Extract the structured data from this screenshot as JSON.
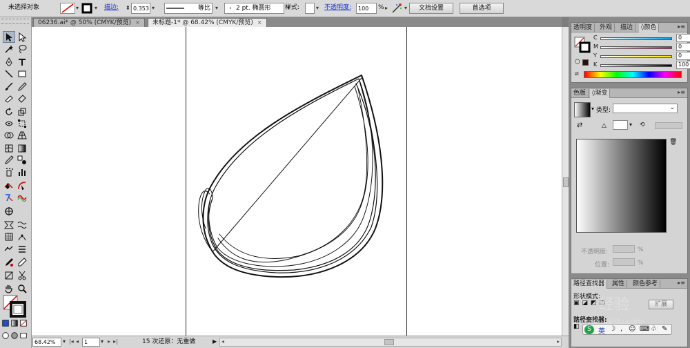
{
  "control_bar": {
    "selection_status": "未选择对象",
    "stroke_label": "描边:",
    "stroke_weight": "0.353",
    "profile_label": "等比",
    "brush_label": "2 pt. 椭圆形",
    "style_label": "样式:",
    "opacity_label": "不透明度:",
    "opacity_value": "100",
    "percent": "%",
    "doc_setup_button": "文档设置",
    "preferences_button": "首选项"
  },
  "document_tabs": [
    {
      "label": "06236.ai* @ 50% (CMYK/预览)",
      "close": "×"
    },
    {
      "label": "未标题-1* @ 68.42% (CMYK/预览)",
      "close": "×"
    }
  ],
  "status_bar": {
    "zoom": "68.42%",
    "page": "1",
    "status_text": "15 次还原：无重做"
  },
  "color_panel": {
    "tabs": [
      "透明度",
      "外观",
      "描边",
      "颜色"
    ],
    "active_tab": "颜色",
    "channels": [
      {
        "label": "C",
        "value": "0",
        "unit": "%"
      },
      {
        "label": "M",
        "value": "0",
        "unit": "%"
      },
      {
        "label": "Y",
        "value": "0",
        "unit": "%"
      },
      {
        "label": "K",
        "value": "100",
        "unit": "%"
      }
    ]
  },
  "gradient_panel": {
    "tabs": [
      "色板",
      "渐变"
    ],
    "active_tab": "渐变",
    "type_label": "类型:",
    "opacity_label": "不透明度:",
    "location_label": "位置:",
    "percent": "%"
  },
  "bottom_panel": {
    "tabs": [
      "路径查找器",
      "属性",
      "颜色参考"
    ],
    "active_tab": "路径查找器",
    "shape_modes_label": "形状模式:",
    "expand_button": "扩展",
    "pathfinders_label": "路径查找器:"
  },
  "watermark": {
    "text": "经验",
    "url": "jingyan.baidu.com"
  },
  "ime_bar": {
    "mode": "英"
  },
  "colors": {
    "ui_gray": "#d4d4d4",
    "workspace": "#8a8a8a",
    "link_blue": "#1a33c8",
    "fill_swatch": "#2b0f0f"
  }
}
